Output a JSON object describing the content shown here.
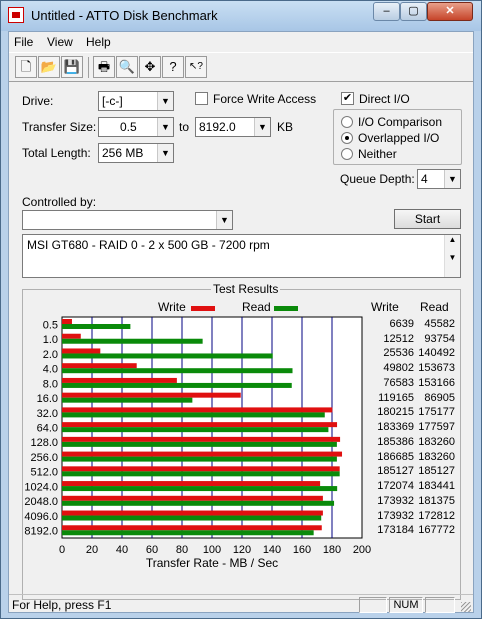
{
  "window": {
    "title": "Untitled - ATTO Disk Benchmark"
  },
  "caption": {
    "min": "–",
    "max": "▢",
    "close": "✕"
  },
  "menu": {
    "file": "File",
    "view": "View",
    "help": "Help"
  },
  "toolbar": {
    "buttons": [
      {
        "name": "new-icon",
        "glyph": "🗋"
      },
      {
        "name": "open-icon",
        "glyph": "📂"
      },
      {
        "name": "save-icon",
        "glyph": "💾"
      },
      {
        "name": "print-icon",
        "glyph": "🖶"
      },
      {
        "name": "print-preview-icon",
        "glyph": "🔍"
      },
      {
        "name": "move-icon",
        "glyph": "✥"
      },
      {
        "name": "help-icon",
        "glyph": "?"
      },
      {
        "name": "context-help-icon",
        "glyph": "↖?"
      }
    ]
  },
  "form": {
    "drive_label": "Drive:",
    "drive_value": "[-c-]",
    "force_write_label": "Force Write Access",
    "force_write_checked": false,
    "direct_io_label": "Direct I/O",
    "direct_io_checked": true,
    "transfer_size_label": "Transfer Size:",
    "transfer_from": "0.5",
    "to_label": "to",
    "transfer_to": "8192.0",
    "kb_label": "KB",
    "total_length_label": "Total Length:",
    "total_length_value": "256 MB",
    "io_options": [
      {
        "label": "I/O Comparison",
        "selected": false
      },
      {
        "label": "Overlapped I/O",
        "selected": true
      },
      {
        "label": "Neither",
        "selected": false
      }
    ],
    "queue_depth_label": "Queue Depth:",
    "queue_depth_value": "4",
    "controlled_by_label": "Controlled by:",
    "controlled_by_value": "",
    "start_label": "Start",
    "description": "MSI GT680 - RAID 0 - 2 x 500 GB - 7200 rpm"
  },
  "results": {
    "title": "Test Results",
    "write_legend": "Write",
    "read_legend": "Read",
    "write_col": "Write",
    "read_col": "Read"
  },
  "colors": {
    "write": "#e01010",
    "read": "#0a8a0a",
    "grid": "#000080"
  },
  "chart_data": {
    "type": "bar",
    "orientation": "horizontal",
    "categories": [
      "0.5",
      "1.0",
      "2.0",
      "4.0",
      "8.0",
      "16.0",
      "32.0",
      "64.0",
      "128.0",
      "256.0",
      "512.0",
      "1024.0",
      "2048.0",
      "4096.0",
      "8192.0"
    ],
    "series": [
      {
        "name": "Write",
        "values": [
          6639,
          12512,
          25536,
          49802,
          76583,
          119165,
          180215,
          183369,
          185386,
          186685,
          185127,
          172074,
          173932,
          173932,
          173184
        ]
      },
      {
        "name": "Read",
        "values": [
          45582,
          93754,
          140492,
          153673,
          153166,
          86905,
          175177,
          177597,
          183260,
          183260,
          185127,
          183441,
          181375,
          172812,
          167772
        ]
      }
    ],
    "xlabel": "Transfer Rate - MB / Sec",
    "x_ticks": [
      "0",
      "20",
      "40",
      "60",
      "80",
      "100",
      "120",
      "140",
      "160",
      "180",
      "200"
    ],
    "xlim": [
      0,
      200
    ],
    "grid": true
  },
  "statusbar": {
    "text": "For Help, press F1",
    "num": "NUM"
  }
}
